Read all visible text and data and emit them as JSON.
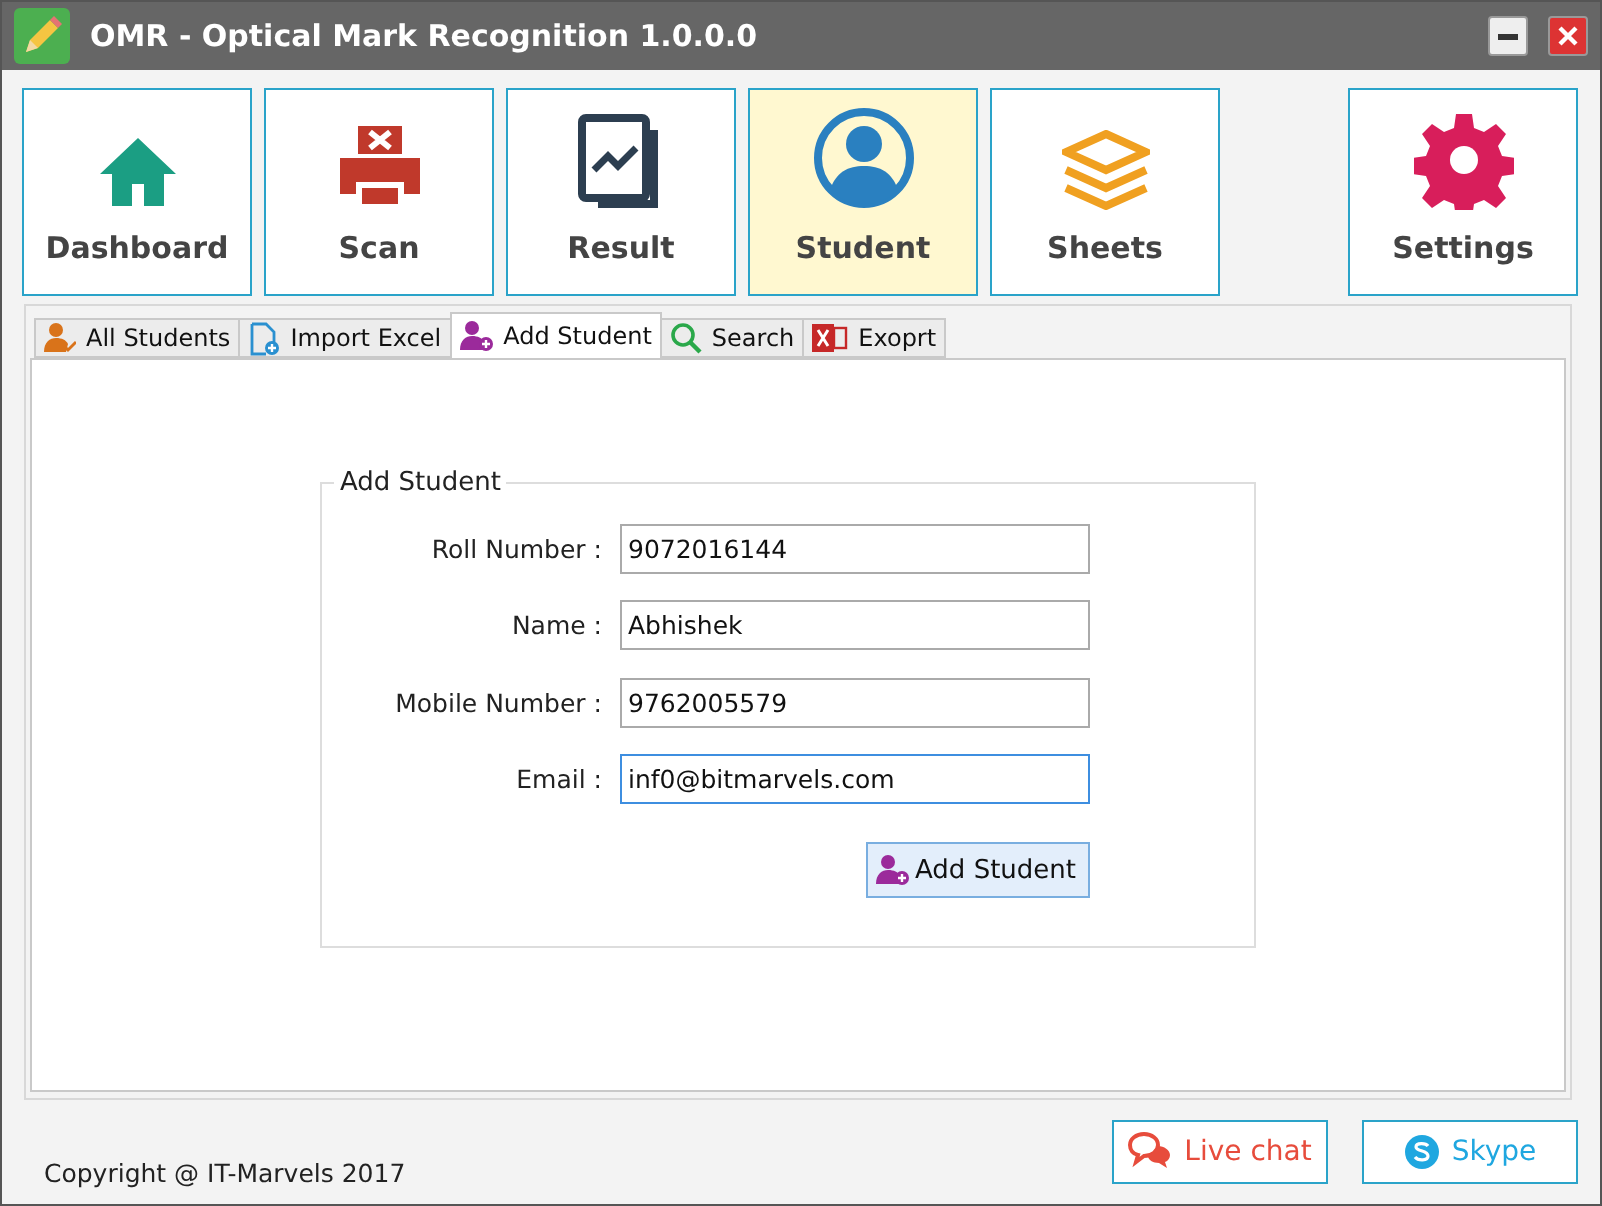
{
  "window": {
    "title": "OMR - Optical Mark Recognition 1.0.0.0"
  },
  "nav": [
    {
      "label": "Dashboard",
      "selected": false
    },
    {
      "label": "Scan",
      "selected": false
    },
    {
      "label": "Result",
      "selected": false
    },
    {
      "label": "Student",
      "selected": true
    },
    {
      "label": "Sheets",
      "selected": false
    },
    {
      "label": "Settings",
      "selected": false
    }
  ],
  "tabs": [
    {
      "label": "All Students",
      "selected": false
    },
    {
      "label": "Import Excel",
      "selected": false
    },
    {
      "label": "Add Student",
      "selected": true
    },
    {
      "label": "Search",
      "selected": false
    },
    {
      "label": "Exoprt",
      "selected": false
    }
  ],
  "form": {
    "legend": "Add Student",
    "fields": [
      {
        "label": "Roll Number :",
        "value": "9072016144",
        "focused": false
      },
      {
        "label": "Name :",
        "value": "Abhishek",
        "focused": false
      },
      {
        "label": "Mobile Number :",
        "value": "9762005579",
        "focused": false
      },
      {
        "label": "Email :",
        "value": "inf0@bitmarvels.com",
        "focused": true
      }
    ],
    "submit": "Add Student"
  },
  "footer": {
    "copyright": "Copyright @ IT-Marvels 2017",
    "buttons": [
      "Live chat",
      "Skype"
    ]
  }
}
